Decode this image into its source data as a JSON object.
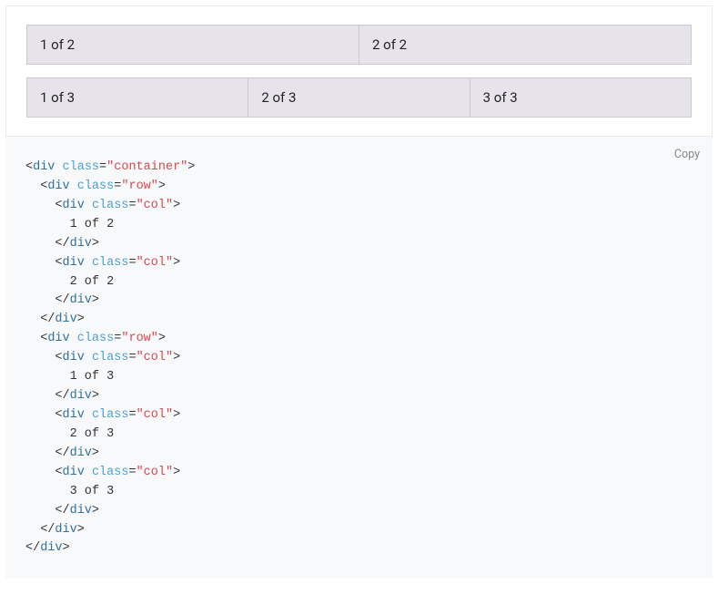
{
  "example": {
    "rows": [
      {
        "cols": [
          "1 of 2",
          "2 of 2"
        ]
      },
      {
        "cols": [
          "1 of 3",
          "2 of 3",
          "3 of 3"
        ]
      }
    ]
  },
  "code": {
    "copy_label": "Copy",
    "tag_div": "div",
    "attr_class": "class",
    "val_container": "container",
    "val_row": "row",
    "val_col": "col",
    "txt_1_of_2": "1 of 2",
    "txt_2_of_2": "2 of 2",
    "txt_1_of_3": "1 of 3",
    "txt_2_of_3": "2 of 3",
    "txt_3_of_3": "3 of 3"
  }
}
